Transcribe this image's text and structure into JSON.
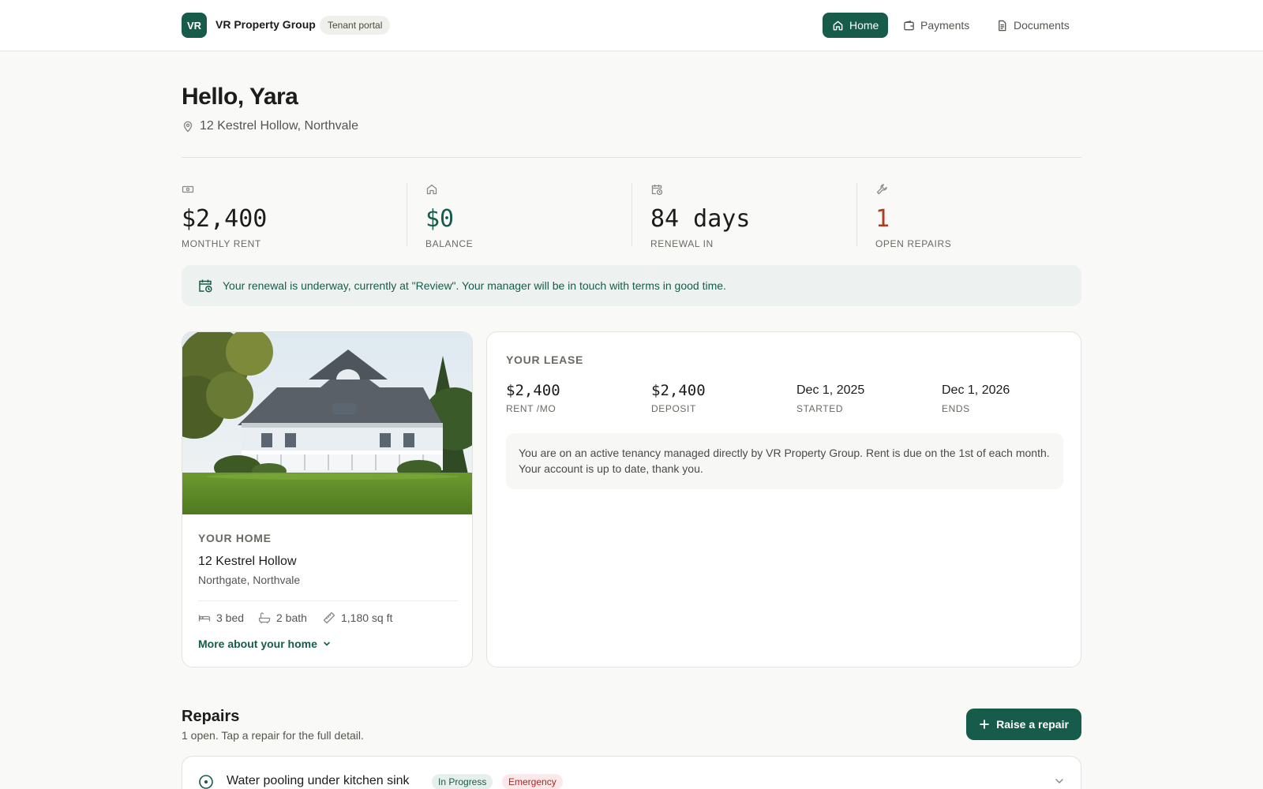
{
  "header": {
    "logo_initials": "VR",
    "brand": "VR Property Group",
    "portal_label": "Tenant portal",
    "nav": [
      {
        "label": "Home",
        "icon": "home-icon",
        "active": true
      },
      {
        "label": "Payments",
        "icon": "wallet-icon",
        "active": false
      },
      {
        "label": "Documents",
        "icon": "document-icon",
        "active": false
      }
    ]
  },
  "greeting": {
    "title": "Hello, Yara",
    "address": "12 Kestrel Hollow, Northvale"
  },
  "stats": [
    {
      "value": "$2,400",
      "label": "MONTHLY RENT",
      "icon": "banknote-icon",
      "color": "#1c1c1a"
    },
    {
      "value": "$0",
      "label": "BALANCE",
      "icon": "home-icon",
      "color": "#175c4b"
    },
    {
      "value": "84 days",
      "label": "RENEWAL IN",
      "icon": "calendar-clock-icon",
      "color": "#1c1c1a"
    },
    {
      "value": "1",
      "label": "OPEN REPAIRS",
      "icon": "wrench-icon",
      "color": "#b33a1f"
    }
  ],
  "banner": {
    "icon": "calendar-clock-icon",
    "text": "Your renewal is underway, currently at \"Review\". Your manager will be in touch with terms in good time."
  },
  "home": {
    "section_label": "YOUR HOME",
    "name": "12 Kestrel Hollow",
    "area": "Northgate, Northvale",
    "features": [
      {
        "icon": "bed-icon",
        "text": "3 bed"
      },
      {
        "icon": "bath-icon",
        "text": "2 bath"
      },
      {
        "icon": "ruler-icon",
        "text": "1,180 sq ft"
      }
    ],
    "more_link": "More about your home"
  },
  "lease": {
    "section_label": "YOUR LEASE",
    "fields": [
      {
        "value": "$2,400",
        "label": "RENT /MO"
      },
      {
        "value": "$2,400",
        "label": "DEPOSIT"
      },
      {
        "value": "Dec 1, 2025",
        "label": "STARTED"
      },
      {
        "value": "Dec 1, 2026",
        "label": "ENDS"
      }
    ],
    "note": "You are on an active tenancy managed directly by VR Property Group. Rent is due on the 1st of each month. Your account is up to date, thank you."
  },
  "repairs": {
    "title": "Repairs",
    "subtitle": "1 open. Tap a repair for the full detail.",
    "raise_button": "Raise a repair",
    "items": [
      {
        "title": "Water pooling under kitchen sink",
        "status": "In Progress",
        "priority": "Emergency"
      }
    ]
  },
  "colors": {
    "accent": "#175c4b",
    "danger": "#b33a1f",
    "background": "#f9f9f7"
  }
}
